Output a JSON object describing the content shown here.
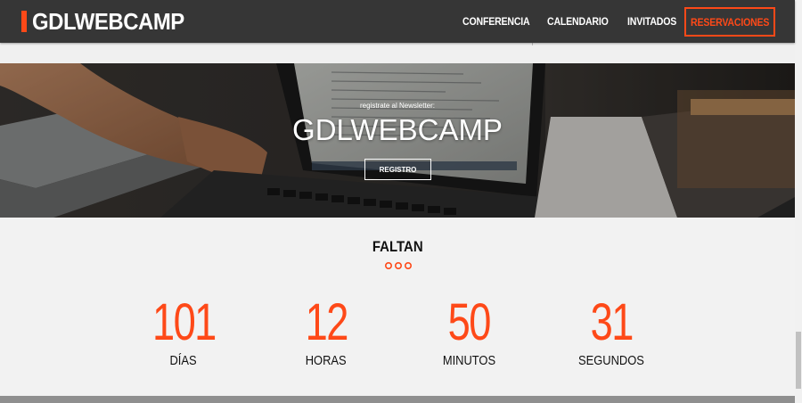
{
  "brand": {
    "logo_text": "GDLWEBCAMP",
    "accent_color": "#fe4918"
  },
  "nav": {
    "links": [
      "CONFERENCIA",
      "CALENDARIO",
      "INVITADOS"
    ],
    "cta_label": "RESERVACIONES"
  },
  "hero": {
    "subtitle": "registrate al Newsletter:",
    "title": "GDLWEBCAMP",
    "button_label": "REGISTRO"
  },
  "countdown": {
    "title": "FALTAN",
    "items": [
      {
        "value": "101",
        "label": "DÍAS"
      },
      {
        "value": "12",
        "label": "HORAS"
      },
      {
        "value": "50",
        "label": "MINUTOS"
      },
      {
        "value": "31",
        "label": "SEGUNDOS"
      }
    ]
  }
}
